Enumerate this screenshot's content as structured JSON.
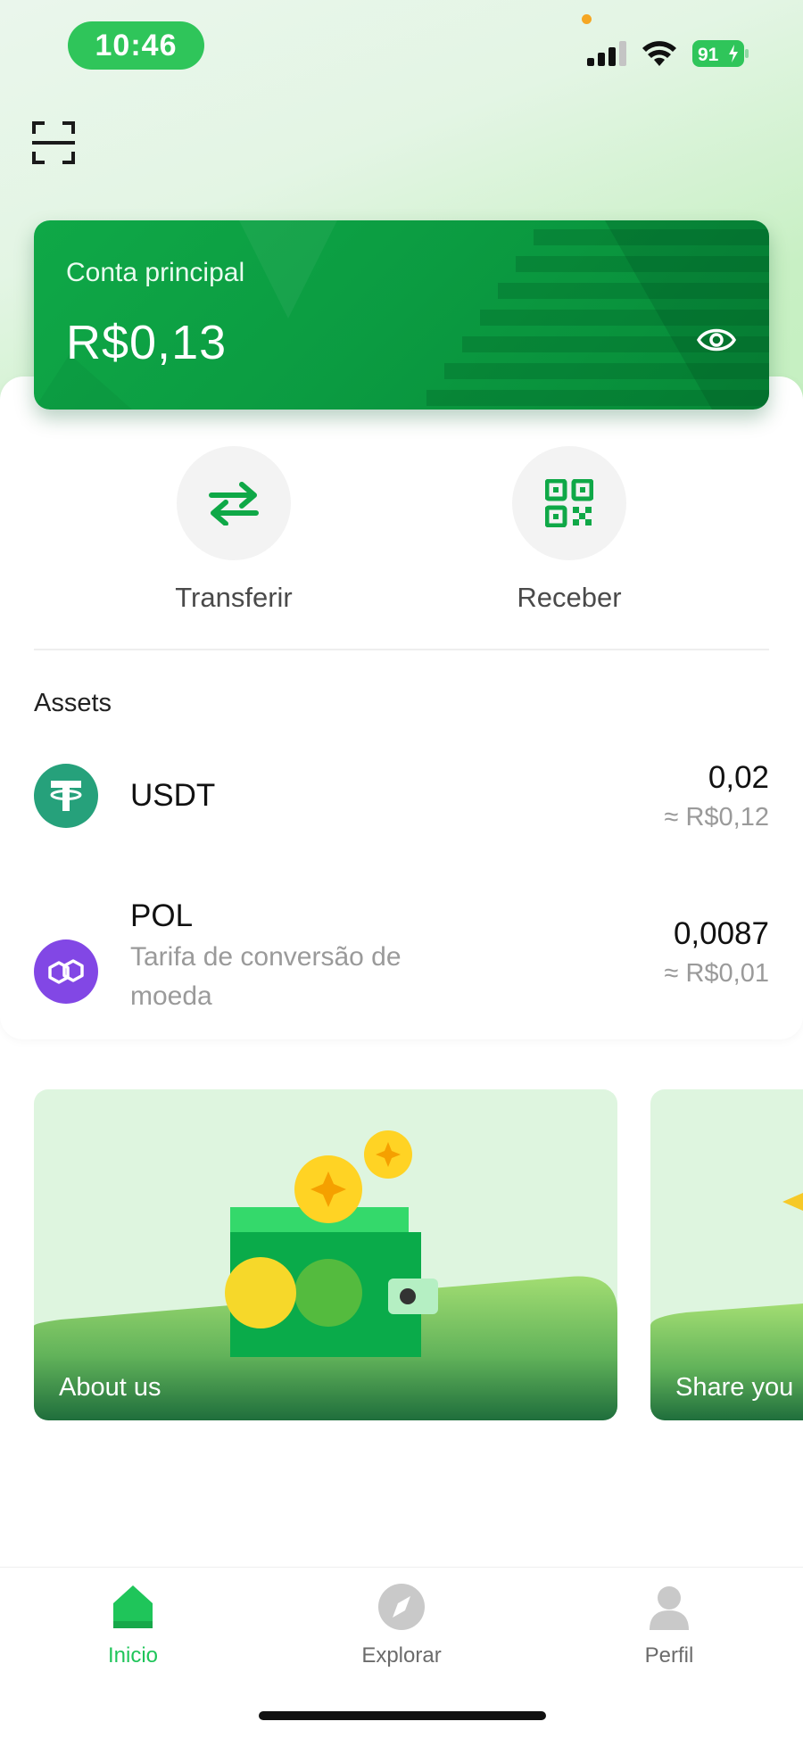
{
  "status_bar": {
    "time": "10:46",
    "battery": "91"
  },
  "account_card": {
    "label": "Conta principal",
    "balance": "R$0,13"
  },
  "actions": {
    "transfer_label": "Transferir",
    "receive_label": "Receber"
  },
  "assets": {
    "title": "Assets",
    "items": [
      {
        "symbol": "USDT",
        "subtitle": "",
        "amount": "0,02",
        "fiat": "≈ R$0,12",
        "color": "#26a17b",
        "icon": "tether-icon"
      },
      {
        "symbol": "POL",
        "subtitle": "Tarifa de conversão de moeda",
        "amount": "0,0087",
        "fiat": "≈ R$0,01",
        "color": "#8247e5",
        "icon": "polygon-icon"
      }
    ]
  },
  "promos": [
    {
      "label": "About us"
    },
    {
      "label": "Share you"
    }
  ],
  "bottom_nav": {
    "items": [
      {
        "label": "Inicio",
        "icon": "home-icon",
        "active": true
      },
      {
        "label": "Explorar",
        "icon": "compass-icon",
        "active": false
      },
      {
        "label": "Perfil",
        "icon": "person-icon",
        "active": false
      }
    ]
  },
  "colors": {
    "brand_green": "#0fa847",
    "nav_active": "#1fc55a",
    "muted_text": "#9a9a9a"
  }
}
